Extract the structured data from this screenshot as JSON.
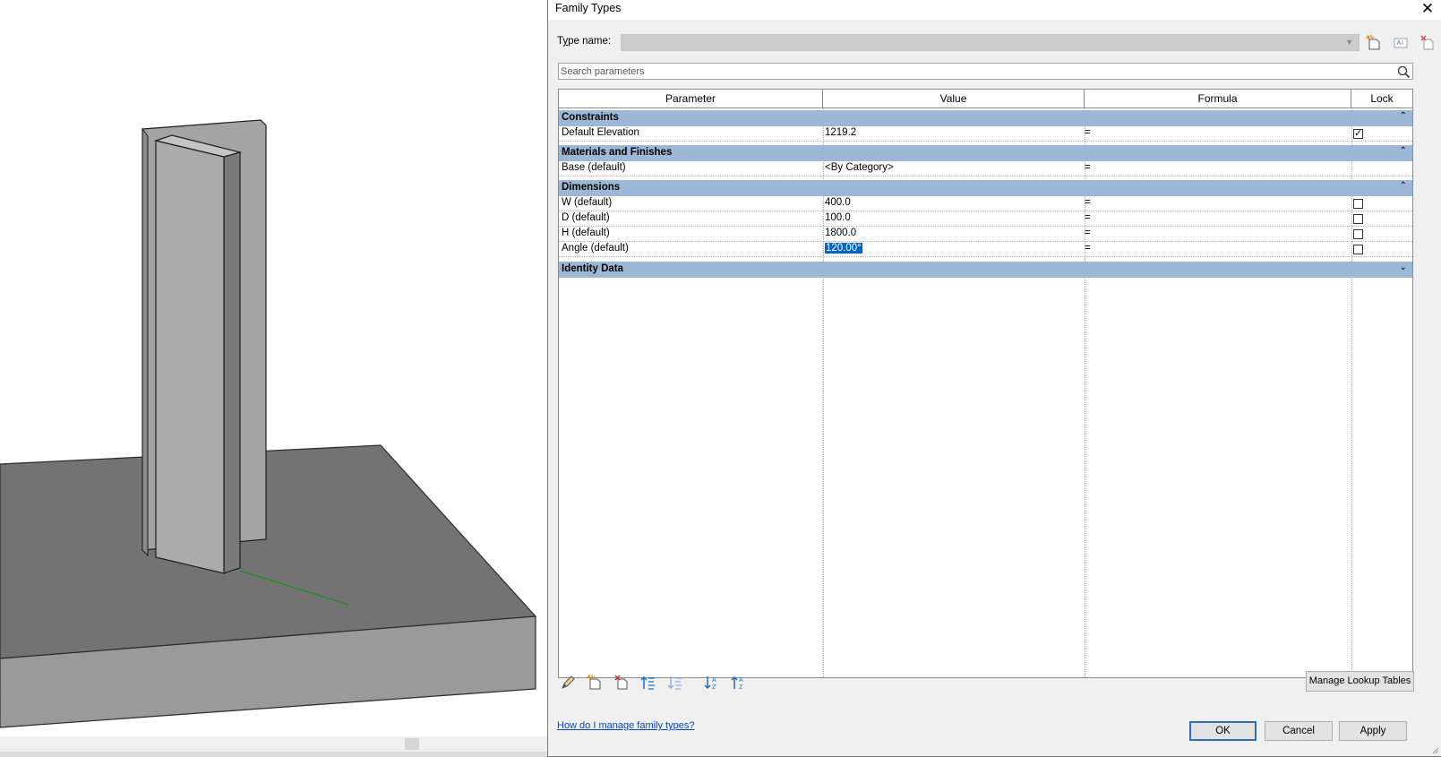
{
  "dialog": {
    "title": "Family Types",
    "close_glyph": "✕",
    "type_name_label_prefix": "T",
    "type_name_label_accel": "y",
    "type_name_label_rest": "pe name:",
    "type_name_value": "",
    "search_placeholder": "Search parameters"
  },
  "grid": {
    "headers": {
      "parameter": "Parameter",
      "value": "Value",
      "formula": "Formula",
      "lock": "Lock"
    },
    "groups": [
      {
        "label": "Constraints",
        "toggle": "⌃"
      },
      {
        "label": "Materials and Finishes",
        "toggle": "⌃"
      },
      {
        "label": "Dimensions",
        "toggle": "⌃"
      },
      {
        "label": "Identity Data",
        "toggle": "⌄"
      }
    ],
    "rows": {
      "default_elevation": {
        "parameter": "Default Elevation",
        "value": "1219.2",
        "formula": "=",
        "locked": true
      },
      "base": {
        "parameter": "Base (default)",
        "value": "<By Category>",
        "formula": "="
      },
      "w": {
        "parameter": "W (default)",
        "value": "400.0",
        "formula": "=",
        "locked": false
      },
      "d": {
        "parameter": "D (default)",
        "value": "100.0",
        "formula": "=",
        "locked": false
      },
      "h": {
        "parameter": "H (default)",
        "value": "1800.0",
        "formula": "=",
        "locked": false
      },
      "angle": {
        "parameter": "Angle (default)",
        "value": "120.00°",
        "formula": "=",
        "locked": false
      }
    }
  },
  "buttons": {
    "manage_lookup": "Manage Lookup Tables",
    "ok": "OK",
    "cancel": "Cancel",
    "apply": "Apply"
  },
  "help_link": "How do I manage family types?",
  "icons": {
    "type_tools": [
      "new-type-icon",
      "rename-type-icon",
      "delete-type-icon"
    ],
    "bottom_tools": [
      "edit-parameter-icon",
      "new-parameter-icon",
      "delete-parameter-icon",
      "move-up-icon",
      "move-down-icon",
      "sort-ascending-icon",
      "sort-descending-icon"
    ]
  },
  "colors": {
    "group_header": "#9cb8d6",
    "selection": "#0a64c8",
    "link": "#0645c8",
    "model_floor_top": "#737373",
    "model_floor_side": "#9a9a9a",
    "model_column_light": "#a8a8a8",
    "model_column_dark": "#7a7a7a",
    "axis_line": "#1f8a1f"
  }
}
